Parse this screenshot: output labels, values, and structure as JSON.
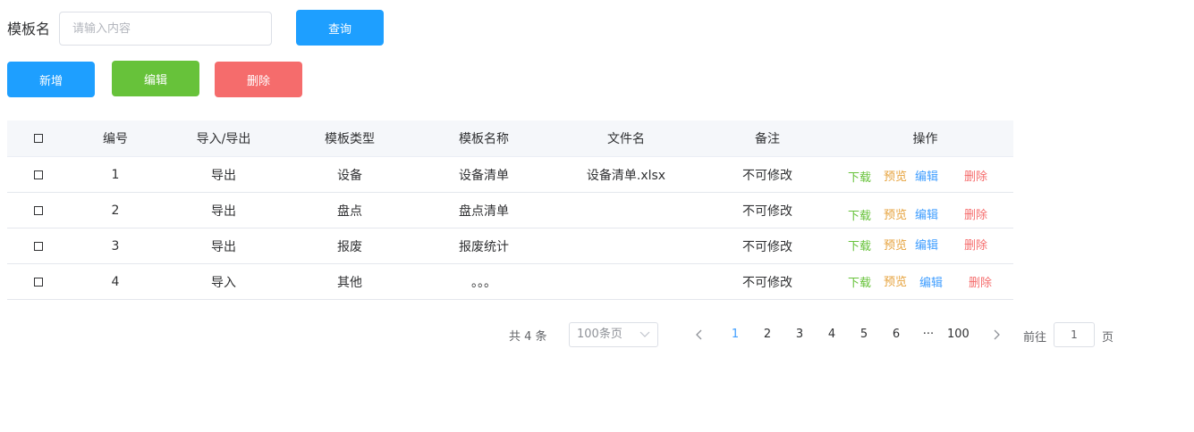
{
  "filter": {
    "label": "模板名",
    "placeholder": "请输入内容",
    "query_label": "查询"
  },
  "actions": {
    "add_label": "新增",
    "edit_label": "编辑",
    "delete_label": "删除"
  },
  "colors": {
    "primary": "#1e9fff",
    "success": "#67c23a",
    "danger": "#f56c6c",
    "warning": "#e6a23c",
    "link": "#409eff",
    "header_bg": "#f5f7fa"
  },
  "table": {
    "headers": {
      "checkbox": "checkbox-icon",
      "no": "编号",
      "io": "导入/导出",
      "type": "模板类型",
      "name": "模板名称",
      "file": "文件名",
      "note": "备注",
      "ops": "操作"
    },
    "rows": [
      {
        "no": "1",
        "io": "导出",
        "type": "设备",
        "name": "设备清单",
        "file": "设备清单.xlsx",
        "note": "不可修改"
      },
      {
        "no": "2",
        "io": "导出",
        "type": "盘点",
        "name": "盘点清单",
        "file": "",
        "note": "不可修改"
      },
      {
        "no": "3",
        "io": "导出",
        "type": "报废",
        "name": "报废统计",
        "file": "",
        "note": "不可修改"
      },
      {
        "no": "4",
        "io": "导入",
        "type": "其他",
        "name": "。。。",
        "file": "",
        "note": "不可修改"
      }
    ],
    "ops": {
      "download": "下载",
      "preview": "预览",
      "edit": "编辑",
      "delete": "删除"
    }
  },
  "pagination": {
    "total": "共 4 条",
    "page_size": "100条页",
    "pages": [
      "1",
      "2",
      "3",
      "4",
      "5",
      "6",
      "···",
      "100"
    ],
    "current": "1",
    "goto_label": "前往",
    "goto_value": "1",
    "page_suffix": "页",
    "prev_icon": "chevron-left-icon",
    "next_icon": "chevron-right-icon"
  }
}
